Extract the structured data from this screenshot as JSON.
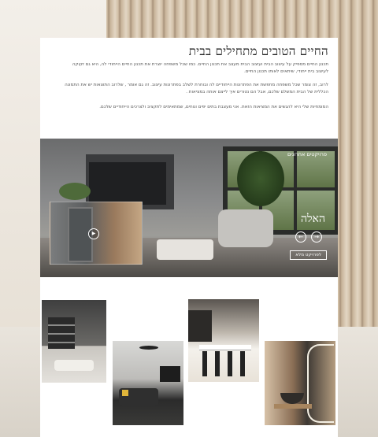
{
  "page": {
    "title": "החיים הטובים מתחילים בבית",
    "paragraphs": [
      "תכנון החיים מספיק על עיצוב הבית ועיצוב הבית מעצב את תכנון החיים. כמו שכל משפחה יוצרת את תכנון החיים הייחודי לה, היא גם זקוקה לעיצוב בית ייחודי, שיתאים לאותו תכנון החיים.",
      "לרוב, זה צומר שכל משפחה מחפשת את הפתרונות הייחודיים לה ובוחרת לשלב בפתרונות עיצוב. זה גם אומר , שלרוב התוצאות יש את התמונה הכללית של הבית המשלם שלכם, אבל הם נטורים איך לייצם אותה במציאות .",
      "המומחיות שלי היא להגשים את המציאות הזאת. אני מעצבת בתים יפים ונוחים, שמתאימים לתקציב ולצרכים הייחודיים שלכם."
    ]
  },
  "hero": {
    "label": "פרויקטים אחרונים",
    "project_name": "האלה",
    "button_label": "לפרויקט מלא",
    "prev_icon": "arrow-left-icon",
    "next_icon": "arrow-right-icon",
    "play_icon": "play-icon"
  },
  "gallery": {
    "items": [
      "living-room-shelves",
      "dark-sofa-living-room",
      "kitchen-bar-stools",
      "bathroom-vanity"
    ]
  },
  "colors": {
    "accent": "#ffffff",
    "text": "#222222"
  }
}
